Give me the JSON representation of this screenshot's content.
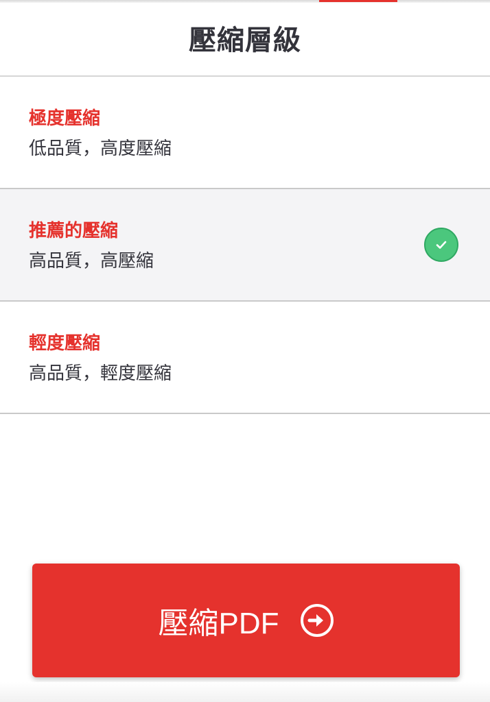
{
  "header": {
    "title": "壓縮層級"
  },
  "options": [
    {
      "title": "極度壓縮",
      "description": "低品質，高度壓縮",
      "selected": false
    },
    {
      "title": "推薦的壓縮",
      "description": "高品質，高壓縮",
      "selected": true
    },
    {
      "title": "輕度壓縮",
      "description": "高品質，輕度壓縮",
      "selected": false
    }
  ],
  "action": {
    "label": "壓縮PDF",
    "icon": "arrow-right-circle-icon"
  },
  "colors": {
    "accent": "#e5322d",
    "selected_background": "#f4f4f6",
    "check": "#4bc77d",
    "text": "#33333b"
  }
}
